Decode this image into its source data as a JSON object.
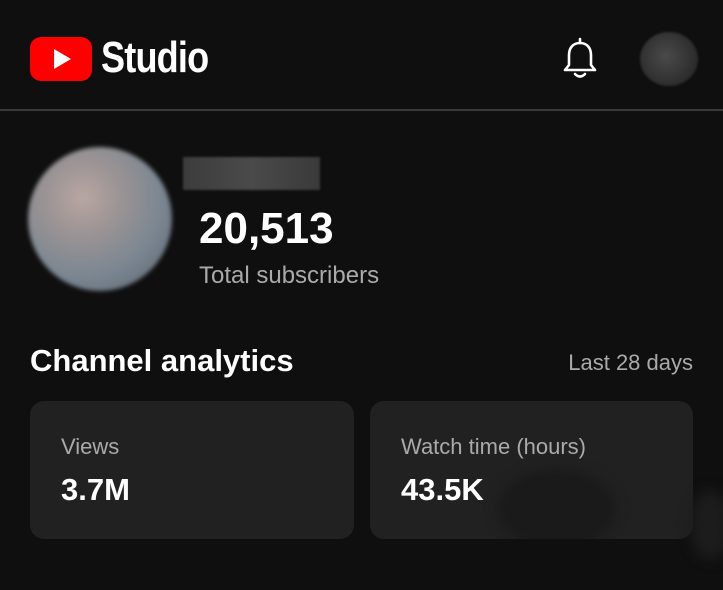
{
  "header": {
    "brand": "Studio",
    "logo_icon": "youtube-play-icon",
    "notifications_icon": "bell-icon",
    "accent_color": "#ff0000"
  },
  "channel": {
    "subscriber_count": "20,513",
    "subscriber_label": "Total subscribers"
  },
  "analytics": {
    "title": "Channel analytics",
    "range": "Last 28 days",
    "cards": [
      {
        "label": "Views",
        "value": "3.7M"
      },
      {
        "label": "Watch time (hours)",
        "value": "43.5K"
      }
    ]
  }
}
